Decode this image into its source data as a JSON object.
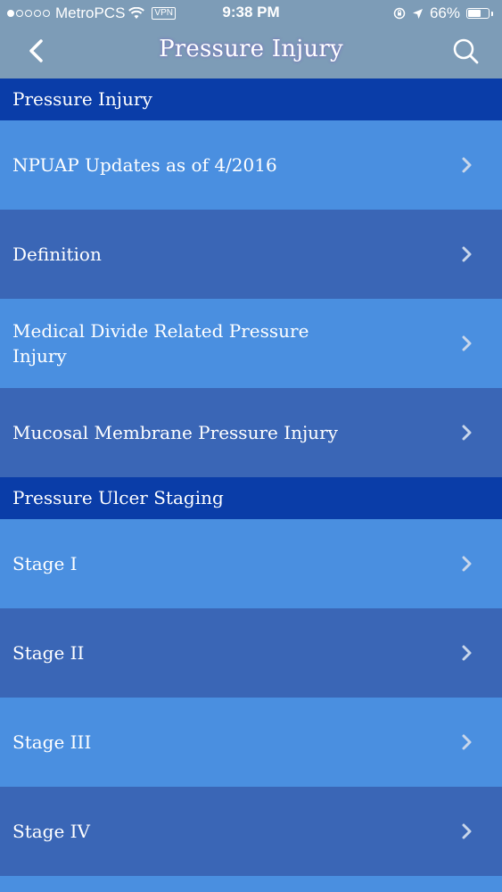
{
  "status_bar": {
    "carrier": "MetroPCS",
    "vpn": "VPN",
    "time": "9:38 PM",
    "battery_percent": "66%",
    "battery_level": 0.66
  },
  "nav": {
    "title": "Pressure Injury",
    "back_icon": "chevron-left-icon",
    "search_icon": "search-icon"
  },
  "sections": [
    {
      "title": "Pressure Injury",
      "items": [
        {
          "label": "NPUAP Updates as of 4/2016"
        },
        {
          "label": "Definition"
        },
        {
          "label": "Medical Divide Related Pressure Injury"
        },
        {
          "label": "Mucosal Membrane Pressure Injury"
        }
      ]
    },
    {
      "title": "Pressure Ulcer Staging",
      "items": [
        {
          "label": "Stage I"
        },
        {
          "label": "Stage II"
        },
        {
          "label": "Stage III"
        },
        {
          "label": "Stage IV"
        }
      ]
    }
  ],
  "colors": {
    "header": "#7d9cb7",
    "section_header": "#0a3da8",
    "row_light": "#4a8fe0",
    "row_dark": "#3a66b6",
    "chevron": "#c8d6ea"
  }
}
